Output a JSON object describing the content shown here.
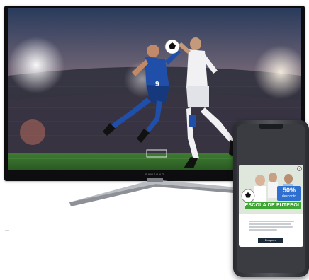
{
  "tv": {
    "brand": "SAMSUNG",
    "scene": "football-players-stadium"
  },
  "phone": {
    "ad": {
      "discount": "50%",
      "discount_label": "desconto",
      "title": "ESCOLA DE FUTEBOL",
      "cta": "Eu quero"
    }
  },
  "colors": {
    "badge": "#2f6fcf",
    "banner": "#3fa535",
    "cta": "#1d2a3a"
  }
}
